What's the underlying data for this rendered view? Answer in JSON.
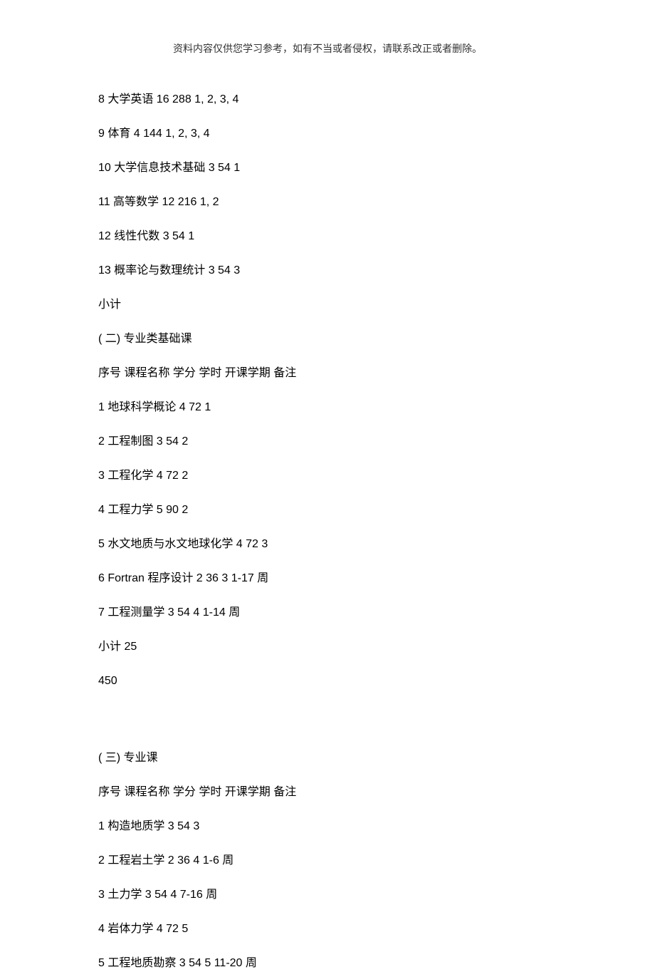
{
  "header": "资料内容仅供您学习参考，如有不当或者侵权，请联系改正或者删除。",
  "lines": [
    "8 大学英语  16 288 1, 2, 3, 4",
    "9 体育 4 144 1, 2, 3, 4",
    "10 大学信息技术基础   3 54 1",
    "11 高等数学  12 216 1, 2",
    "12 线性代数  3 54 1",
    "13 概率论与数理统计   3 54 3",
    "小计",
    "( 二)  专业类基础课",
    "序号  课程名称   学分  学时  开课学期   备注",
    "1 地球科学概论  4 72 1",
    "2 工程制图  3 54 2",
    "3 工程化学  4 72 2",
    "4 工程力学  5 90 2",
    "5 水文地质与水文地球化学   4 72 3",
    "6 Fortran   程序设计  2 36 3 1-17    周",
    "7 工程测量学  3 54 4 1-14    周",
    "小计  25",
    "450"
  ],
  "lines2": [
    "( 三)  专业课",
    "序号  课程名称   学分  学时  开课学期   备注",
    "1 构造地质学  3 54 3",
    "2 工程岩土学  2 36 4 1-6    周",
    "3 土力学  3 54 4 7-16    周",
    "4 岩体力学  4 72 5",
    "5 工程地质勘察  3 54 5 11-20    周"
  ]
}
